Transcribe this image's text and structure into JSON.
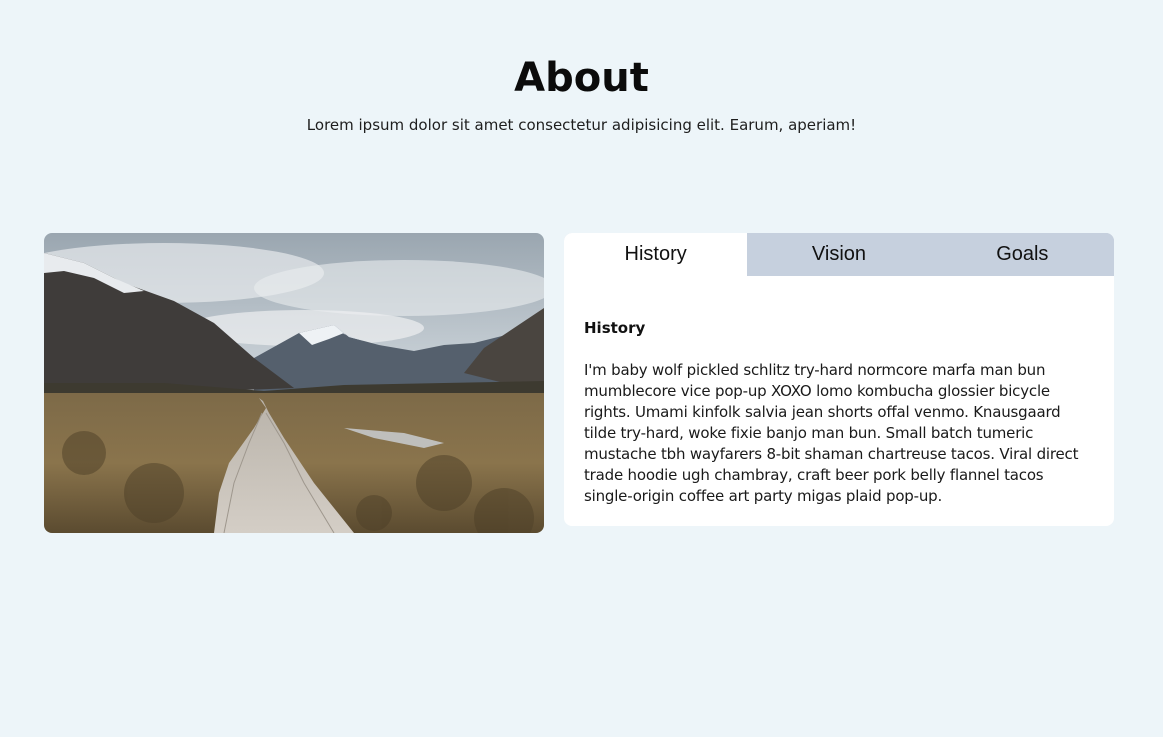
{
  "header": {
    "title": "About",
    "subtitle": "Lorem ipsum dolor sit amet consectetur adipisicing elit. Earum, aperiam!"
  },
  "tabs": [
    {
      "label": "History",
      "active": true
    },
    {
      "label": "Vision",
      "active": false
    },
    {
      "label": "Goals",
      "active": false
    }
  ],
  "panel": {
    "title": "History",
    "text": "I'm baby wolf pickled schlitz try-hard normcore marfa man bun mumblecore vice pop-up XOXO lomo kombucha glossier bicycle rights. Umami kinfolk salvia jean shorts offal venmo. Knausgaard tilde try-hard, woke fixie banjo man bun. Small batch tumeric mustache tbh wayfarers 8-bit shaman chartreuse tacos. Viral direct trade hoodie ugh chambray, craft beer pork belly flannel tacos single-origin coffee art party migas plaid pop-up."
  },
  "colors": {
    "background": "#edf5f9",
    "tab_inactive": "#c6d0de",
    "tab_active": "#ffffff",
    "card": "#ffffff"
  }
}
